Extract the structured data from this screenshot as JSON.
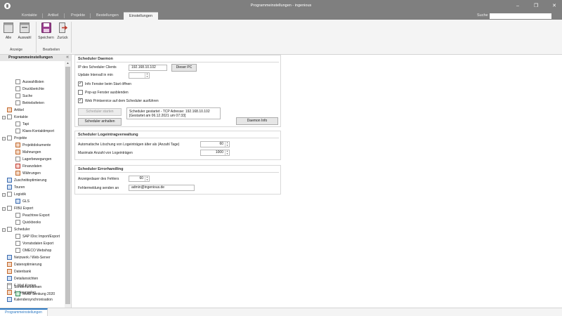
{
  "window": {
    "title": "Programmeinstellungen - ingenious"
  },
  "tabs": [
    "Kontakte",
    "Artikel",
    "Projekte",
    "Bestellungen",
    "Einstellungen"
  ],
  "search": {
    "label": "Suche",
    "value": ""
  },
  "ribbon": {
    "groups": [
      {
        "label": "Anzeige",
        "buttons": [
          "Alle",
          "Auswahl"
        ]
      },
      {
        "label": "Bearbeiten",
        "buttons": [
          "Speichern",
          "Zurück"
        ]
      }
    ]
  },
  "sidebar": {
    "title": "Programmeinstellungen",
    "items": [
      "Auswahllisten",
      "Druckberichte",
      "Suche",
      "Betriebsferien",
      "Artikel",
      "Kontakte",
      "Tapi",
      "Klaes-Kontaktimport",
      "Projekte",
      "Projektdokumente",
      "Mahnungen",
      "Lagerbewegungen",
      "Finanzdaten",
      "Währungen",
      "Zuschnittoptimierung",
      "Touren",
      "Logistik",
      "GLS",
      "FIBU Export",
      "Peachtree Export",
      "Quickbooks",
      "Scheduler",
      "SAP IDoc Import/Export",
      "Vorratsdaten Export",
      "OMECO Webshop",
      "Netzwerk / Web-Server",
      "Datenoptimierung",
      "Datenbank",
      "Detailansichten",
      "E-Mail Konten",
      "Änderungslog",
      "Kalendersynchronisation",
      "Sonderfunktionen",
      "MwSt Senkung 2020"
    ]
  },
  "daemon": {
    "title": "Scheduler Daemon",
    "ip_label": "IP des Scheduler Clients",
    "ip_value": "192.168.10.102",
    "this_pc_button": "Dieser PC",
    "interval_label": "Update Intervall in min",
    "interval_value": "",
    "chk_info": "Info Fenster beim Start öffnen",
    "chk_popup": "Pop-up Fenster ausblenden",
    "chk_web": "Web Printservice auf dem Scheduler ausführen",
    "start_button": "Scheduler starten",
    "stop_button": "Scheduler anhalten",
    "status_line1": "Scheduler gestartet - TCP Adresse: 192.168.10.102",
    "status_line2": "[Gestartet am 06.12.2021 um 07:33]",
    "info_button": "Daemon Info"
  },
  "log": {
    "title": "Scheduler Logeintragverwaltung",
    "auto_delete_label": "Automatische Löschung von Logeinträgen älter als (Anzahl Tage)",
    "auto_delete_value": "60",
    "max_label": "Maximale Anzahl von Logeinträgen",
    "max_value": "1000"
  },
  "errors": {
    "title": "Scheduler Errorhandling",
    "duration_label": "Anzeigedauer des Fehlers",
    "duration_value": "60",
    "send_label": "Fehlermeldung senden an",
    "send_value": "admin@ingenious.de"
  },
  "bottom_tab": "Programmeinstellungen"
}
